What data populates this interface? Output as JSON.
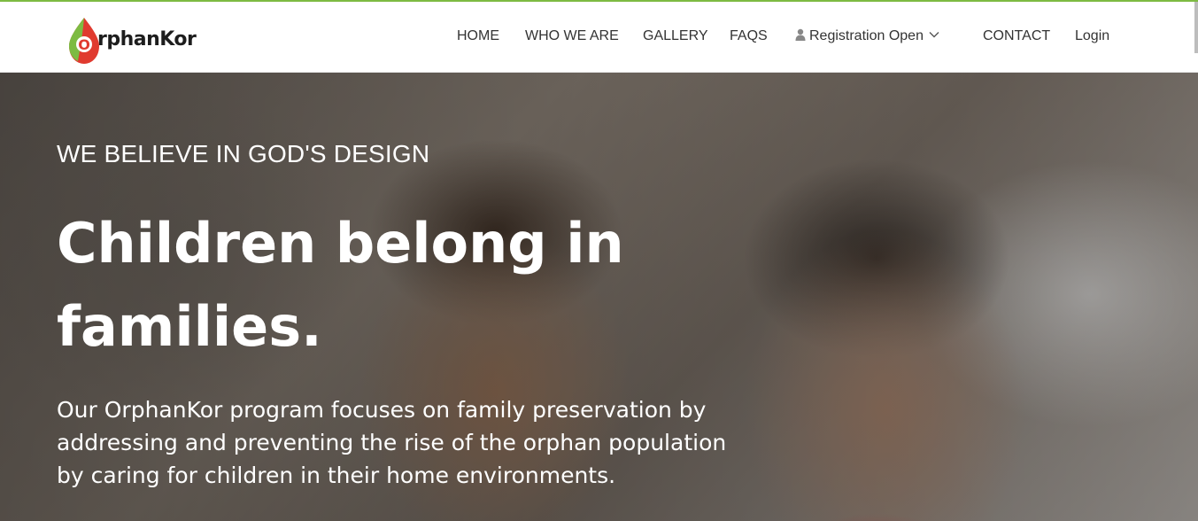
{
  "brand": {
    "logo_text": "rphanKor",
    "logo_initial": "O",
    "colors": {
      "green": "#7dbb42",
      "red": "#e03a2f"
    }
  },
  "nav": {
    "items": [
      {
        "label": "HOME"
      },
      {
        "label": "WHO WE ARE"
      },
      {
        "label": "GALLERY"
      },
      {
        "label": "FAQS"
      },
      {
        "label": "Registration Open",
        "icon": "user-icon",
        "dropdown_icon": "chevron-down-icon"
      },
      {
        "label": "CONTACT"
      },
      {
        "label": "Login"
      }
    ]
  },
  "hero": {
    "tagline": "WE BELIEVE IN GOD'S DESIGN",
    "headline_line1": "Children belong in",
    "headline_line2": "families.",
    "body": "Our OrphanKor program focuses on family preservation by addressing and preventing the rise of the orphan population by caring for children in their home environments."
  }
}
